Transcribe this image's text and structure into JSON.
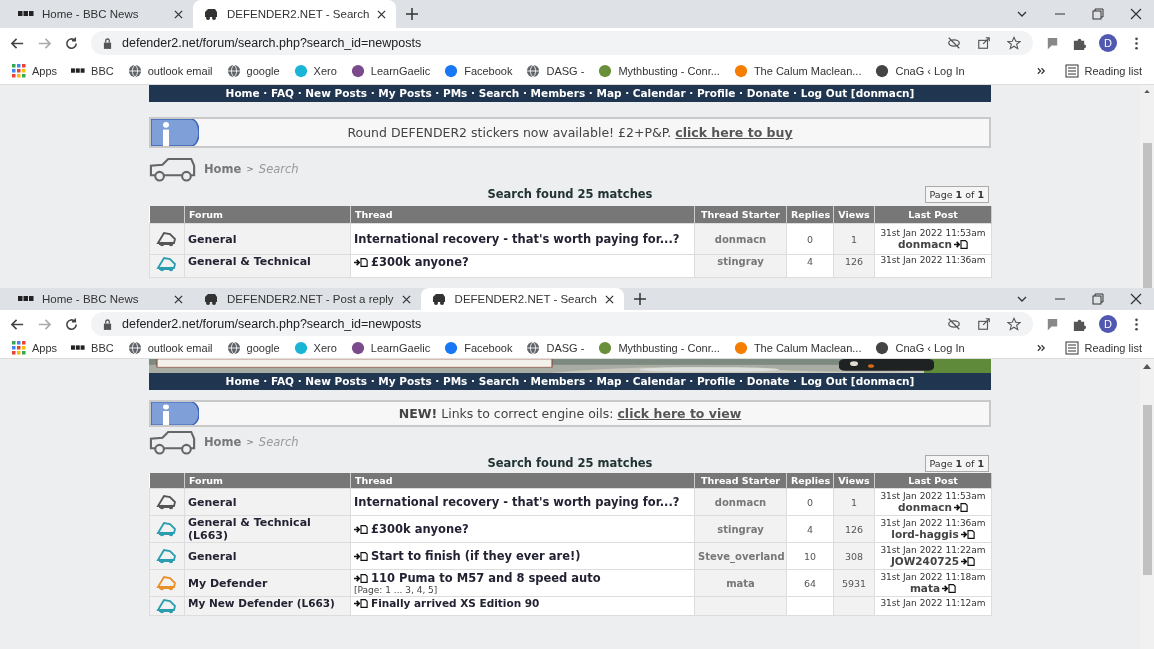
{
  "windows": [
    {
      "tabs": [
        {
          "title": "Home - BBC News",
          "kind": "bbc",
          "selected": false
        },
        {
          "title": "DEFENDER2.NET - Search",
          "kind": "site",
          "selected": true
        }
      ],
      "url": "defender2.net/forum/search.php?search_id=newposts",
      "bookmarks": [
        {
          "label": "Apps",
          "kind": "apps"
        },
        {
          "label": "BBC",
          "kind": "bbc"
        },
        {
          "label": "outlook email",
          "kind": "globe",
          "color": "#5f6368"
        },
        {
          "label": "google",
          "kind": "globe",
          "color": "#5f6368"
        },
        {
          "label": "Xero",
          "kind": "dot",
          "color": "#1ab4d7"
        },
        {
          "label": "LearnGaelic",
          "kind": "dot",
          "color": "#7b4a8c"
        },
        {
          "label": "Facebook",
          "kind": "dot",
          "color": "#1877f2"
        },
        {
          "label": "DASG -",
          "kind": "globe",
          "color": "#5f6368"
        },
        {
          "label": "Mythbusting - Conr...",
          "kind": "dot",
          "color": "#6a8f3a"
        },
        {
          "label": "The Calum Maclean...",
          "kind": "dot",
          "color": "#f57d00"
        },
        {
          "label": "CnaG ‹ Log In",
          "kind": "dot",
          "color": "#444444"
        }
      ],
      "reading_list": "Reading list",
      "profile": "D",
      "forum": {
        "banner": false,
        "nav": "Home · FAQ · New Posts · My Posts · PMs · Search · Members · Map · Calendar · Profile · Donate · Log Out [donmacn]",
        "notice": "Round DEFENDER2 stickers now available! £2+P&P. ",
        "notice_link": "click here to buy",
        "crumb_home": "Home",
        "crumb_sep": ">",
        "crumb_current": "Search",
        "title": "Search found 25 matches",
        "page": "Page **1** of **1**",
        "columns": [
          "Forum",
          "Thread",
          "Thread Starter",
          "Replies",
          "Views",
          "Last Post"
        ],
        "rows": [
          {
            "forum": "General",
            "color": "#555555",
            "new": false,
            "thread": "International recovery - that's worth paying for...?",
            "starter": "donmacn",
            "replies": "0",
            "views": "1",
            "date": "31st Jan 2022 11:53am",
            "poster": "donmacn"
          },
          {
            "forum": "General & Technical",
            "color": "#2a9db0",
            "new": true,
            "thread": "£300k anyone?",
            "starter": "stingray",
            "replies": "4",
            "views": "126",
            "date": "31st Jan 2022 11:36am"
          }
        ]
      }
    },
    {
      "tabs": [
        {
          "title": "Home - BBC News",
          "kind": "bbc",
          "selected": false
        },
        {
          "title": "DEFENDER2.NET - Post a reply",
          "kind": "site",
          "selected": false
        },
        {
          "title": "DEFENDER2.NET - Search",
          "kind": "site",
          "selected": true
        }
      ],
      "url": "defender2.net/forum/search.php?search_id=newposts",
      "bookmarks": [
        {
          "label": "Apps",
          "kind": "apps"
        },
        {
          "label": "BBC",
          "kind": "bbc"
        },
        {
          "label": "outlook email",
          "kind": "globe",
          "color": "#5f6368"
        },
        {
          "label": "google",
          "kind": "globe",
          "color": "#5f6368"
        },
        {
          "label": "Xero",
          "kind": "dot",
          "color": "#1ab4d7"
        },
        {
          "label": "LearnGaelic",
          "kind": "dot",
          "color": "#7b4a8c"
        },
        {
          "label": "Facebook",
          "kind": "dot",
          "color": "#1877f2"
        },
        {
          "label": "DASG -",
          "kind": "globe",
          "color": "#5f6368"
        },
        {
          "label": "Mythbusting - Conr...",
          "kind": "dot",
          "color": "#6a8f3a"
        },
        {
          "label": "The Calum Maclean...",
          "kind": "dot",
          "color": "#f57d00"
        },
        {
          "label": "CnaG ‹ Log In",
          "kind": "dot",
          "color": "#444444"
        }
      ],
      "reading_list": "Reading list",
      "profile": "D",
      "forum": {
        "banner": true,
        "nav": "Home · FAQ · New Posts · My Posts · PMs · Search · Members · Map · Calendar · Profile · Donate · Log Out [donmacn]",
        "notice": "**NEW!** Links to correct engine oils: ",
        "notice_link": "click here to view",
        "crumb_home": "Home",
        "crumb_sep": ">",
        "crumb_current": "Search",
        "title": "Search found 25 matches",
        "page": "Page **1** of **1**",
        "columns": [
          "Forum",
          "Thread",
          "Thread Starter",
          "Replies",
          "Views",
          "Last Post"
        ],
        "rows": [
          {
            "forum": "General",
            "color": "#555555",
            "new": false,
            "thread": "International recovery - that's worth paying for...?",
            "starter": "donmacn",
            "replies": "0",
            "views": "1",
            "date": "31st Jan 2022 11:53am",
            "poster": "donmacn"
          },
          {
            "forum": "General & Technical (L663)",
            "color": "#2a9db0",
            "new": true,
            "thread": "£300k anyone?",
            "starter": "stingray",
            "replies": "4",
            "views": "126",
            "date": "31st Jan 2022 11:36am",
            "poster": "lord-haggis"
          },
          {
            "forum": "General",
            "color": "#2a9db0",
            "new": true,
            "thread": "Start to finish (if they ever are!)",
            "starter": "Steve_overland",
            "replies": "10",
            "views": "308",
            "date": "31st Jan 2022 11:22am",
            "poster": "JOW240725"
          },
          {
            "forum": "My Defender",
            "color": "#e8912a",
            "new": true,
            "thread": "110 Puma to M57 and 8 speed auto",
            "pages": "[Page: 1 ... 3, 4, 5]",
            "starter": "mata",
            "replies": "64",
            "views": "5931",
            "date": "31st Jan 2022 11:18am",
            "poster": "mata"
          },
          {
            "forum": "My New Defender (L663)",
            "color": "#2a9db0",
            "new": true,
            "thread": "Finally arrived XS Edition 90",
            "date": "31st Jan 2022 11:12am"
          }
        ]
      }
    }
  ]
}
